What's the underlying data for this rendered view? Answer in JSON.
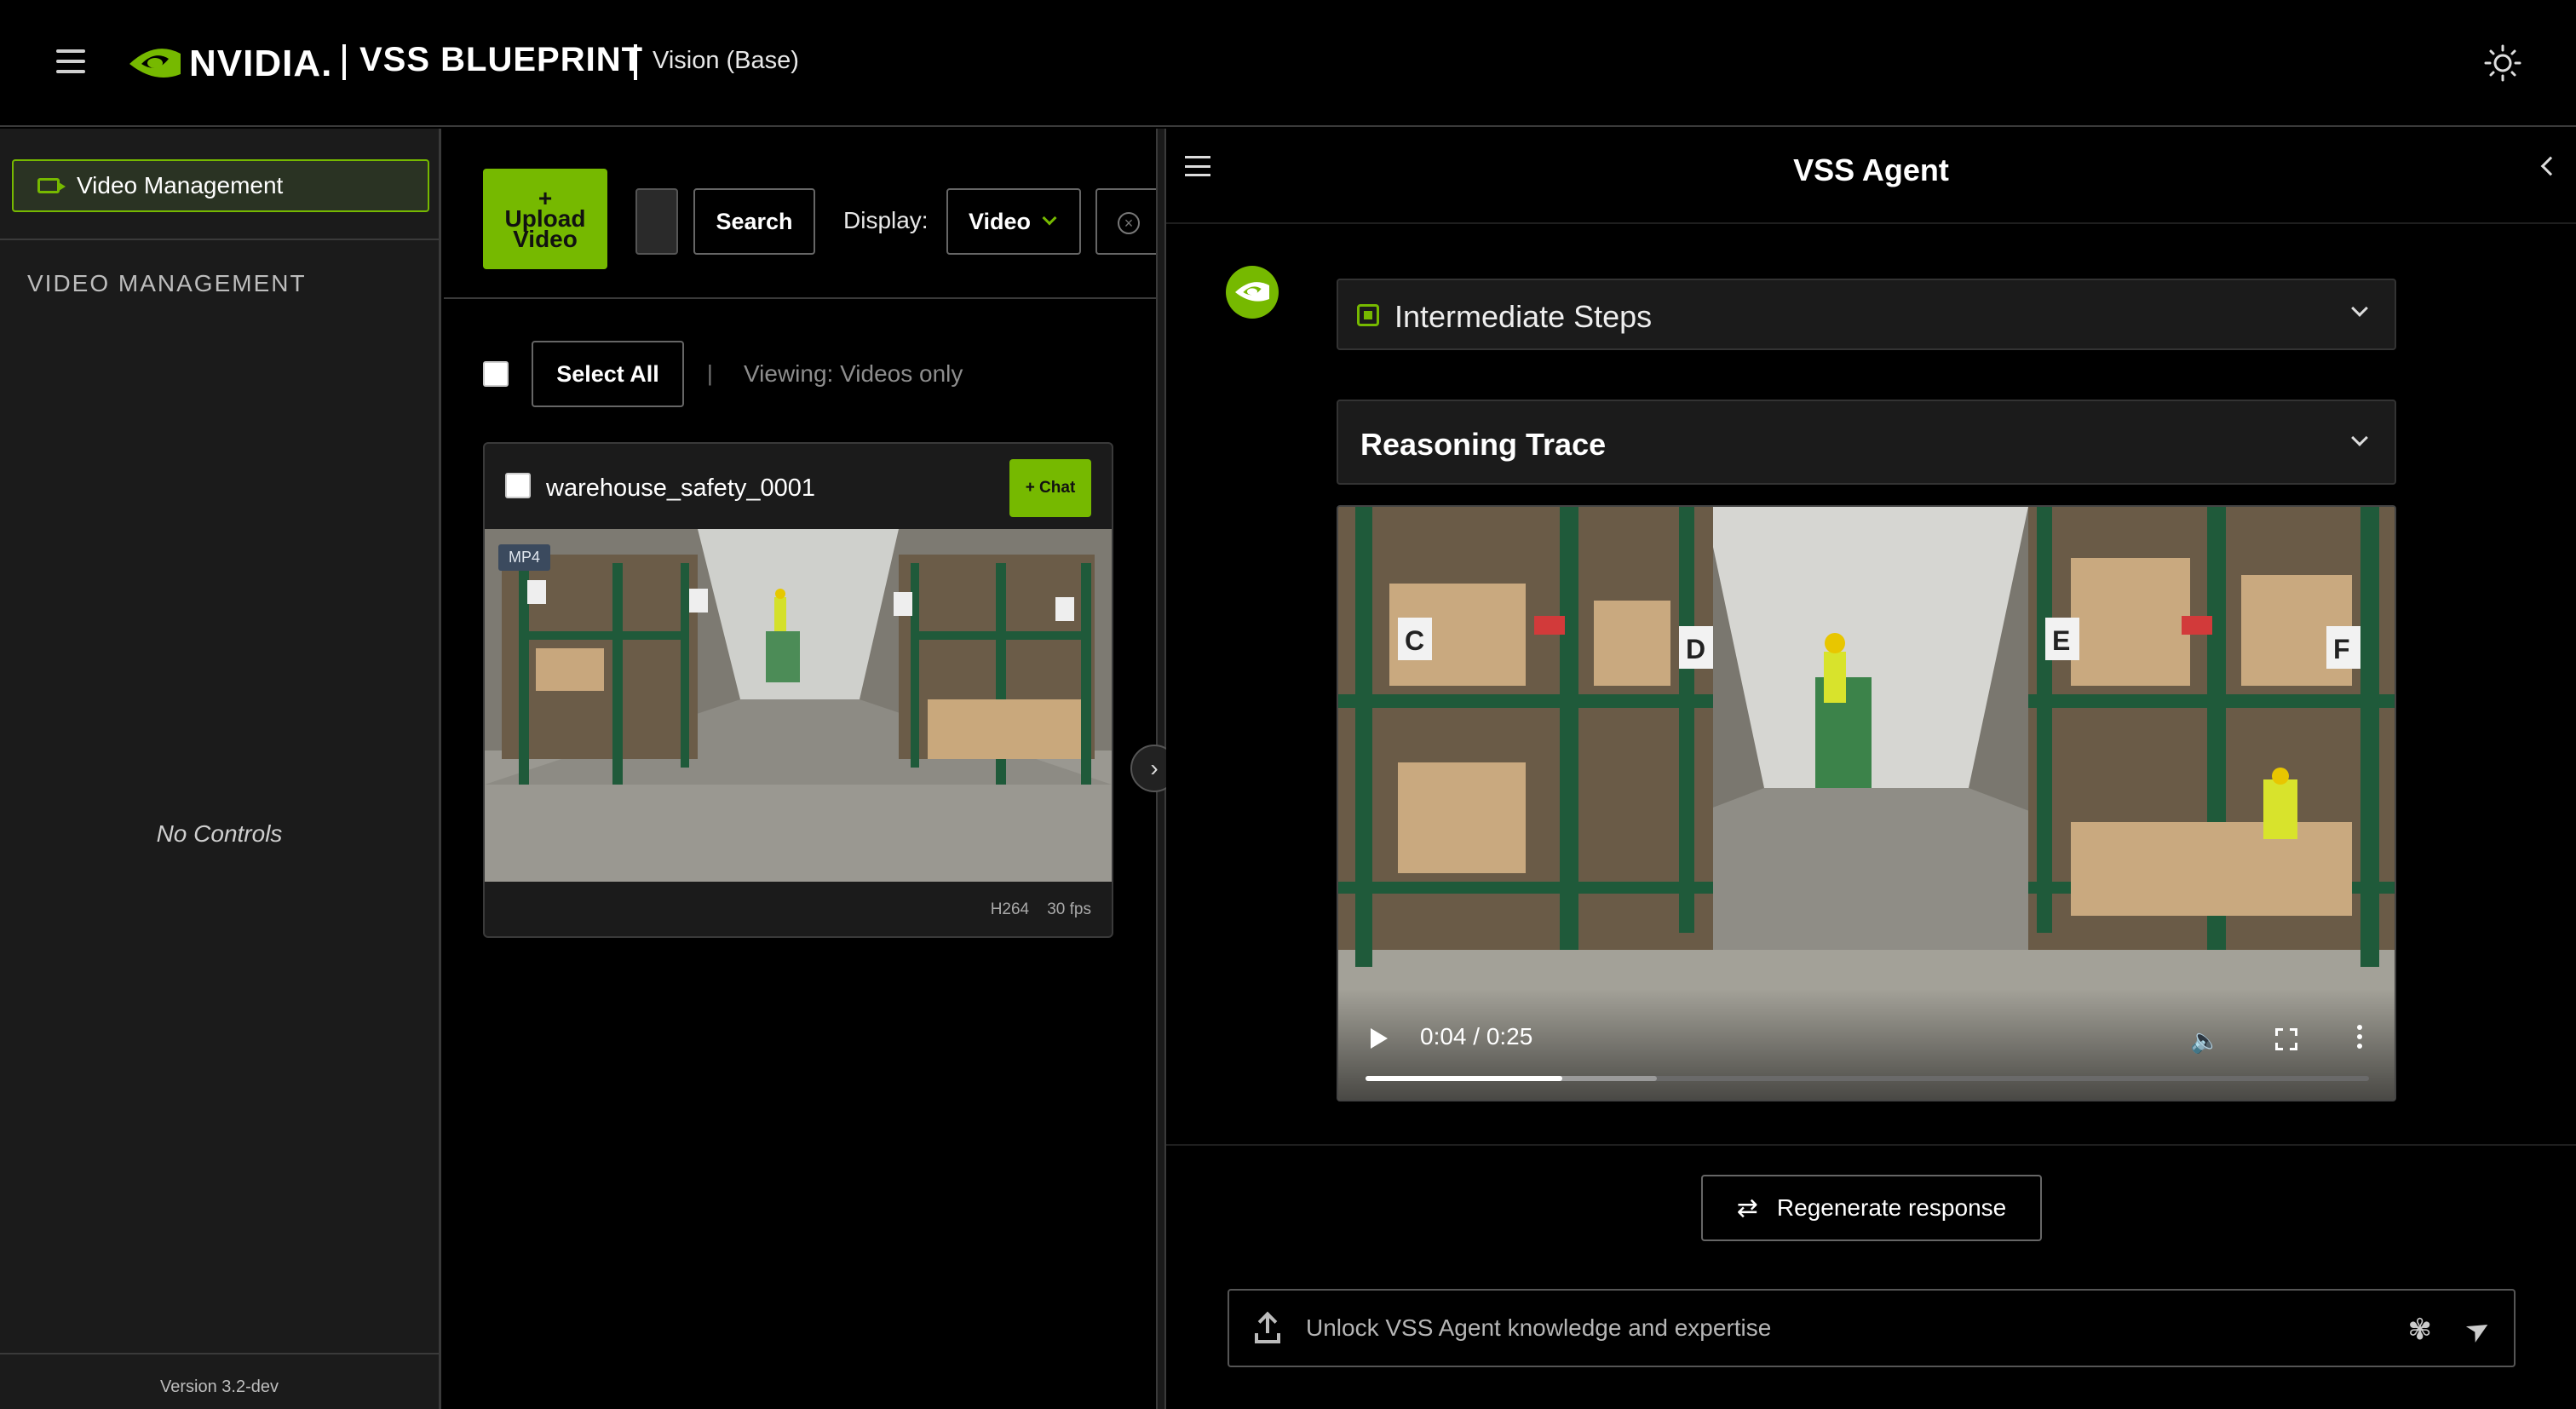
{
  "header": {
    "logo_text": "NVIDIA.",
    "title": "VSS BLUEPRINT",
    "subtitle": "Vision (Base)"
  },
  "sidebar": {
    "nav_item": "Video Management",
    "section_heading": "VIDEO MANAGEMENT",
    "empty_text": "No Controls",
    "version": "Version 3.2-dev"
  },
  "toolbar": {
    "upload_label": "+\nUpload\nVideo",
    "search_label": "Search",
    "display_label": "Display:",
    "display_value": "Video"
  },
  "list": {
    "select_all_label": "Select All",
    "separator": "|",
    "viewing_text": "Viewing: Videos only"
  },
  "video_card": {
    "title": "warehouse_safety_0001",
    "chat_label": "+ Chat",
    "format_badge": "MP4",
    "codec": "H264",
    "fps": "30 fps"
  },
  "agent": {
    "title": "VSS Agent",
    "intermediate_steps": "Intermediate Steps",
    "reasoning_trace": "Reasoning Trace",
    "video_time": "0:04 / 0:25",
    "video_progress": 0.196,
    "video_buffered": 0.29,
    "regenerate_label": "Regenerate response",
    "input_placeholder": "Unlock VSS Agent knowledge and expertise"
  },
  "colors": {
    "accent": "#76b900",
    "background": "#000000",
    "panel": "#1b1b1b"
  },
  "icons": [
    "hamburger-icon",
    "nvidia-logo-icon",
    "sun-icon",
    "camera-icon",
    "close-circle-icon",
    "chevron-right-icon",
    "chevron-left-icon",
    "chip-icon",
    "chevron-down-icon",
    "play-icon",
    "volume-icon",
    "fullscreen-icon",
    "more-icon",
    "refresh-icon",
    "upload-icon",
    "brain-icon",
    "send-icon"
  ]
}
